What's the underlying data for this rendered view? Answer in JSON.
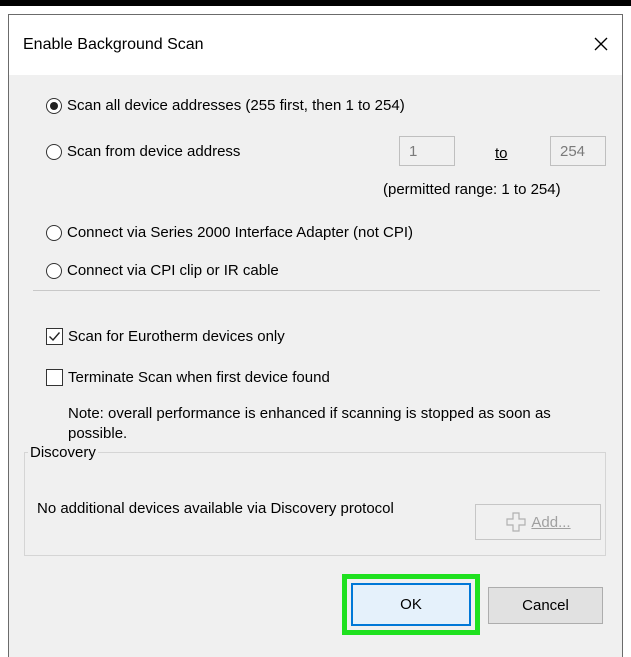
{
  "dialog": {
    "title": "Enable Background Scan",
    "close_label": "✕"
  },
  "scan_options": {
    "scan_all": {
      "label": "Scan all device addresses (255 first, then 1 to 254)",
      "selected": true
    },
    "scan_from": {
      "label": "Scan from device address",
      "selected": false,
      "from_value": "1",
      "to_label": "to",
      "to_value": "254",
      "range_note": "(permitted range: 1 to 254)"
    },
    "series2000": {
      "label": "Connect via Series 2000 Interface Adapter (not CPI)",
      "selected": false
    },
    "cpi_clip": {
      "label": "Connect via CPI clip or IR cable",
      "selected": false
    }
  },
  "checkboxes": {
    "eurotherm_only": {
      "label": "Scan for Eurotherm devices only",
      "checked": true
    },
    "terminate_first": {
      "label": "Terminate Scan when first device found",
      "checked": false
    },
    "note": "Note: overall performance is enhanced if scanning is stopped as soon as possible."
  },
  "discovery": {
    "legend": "Discovery",
    "message": "No additional devices available via Discovery protocol",
    "add_label": "Add..."
  },
  "buttons": {
    "ok_label": "OK",
    "cancel_label": "Cancel"
  },
  "colors": {
    "highlight": "#1fe11f",
    "focus_border": "#0078d7"
  }
}
